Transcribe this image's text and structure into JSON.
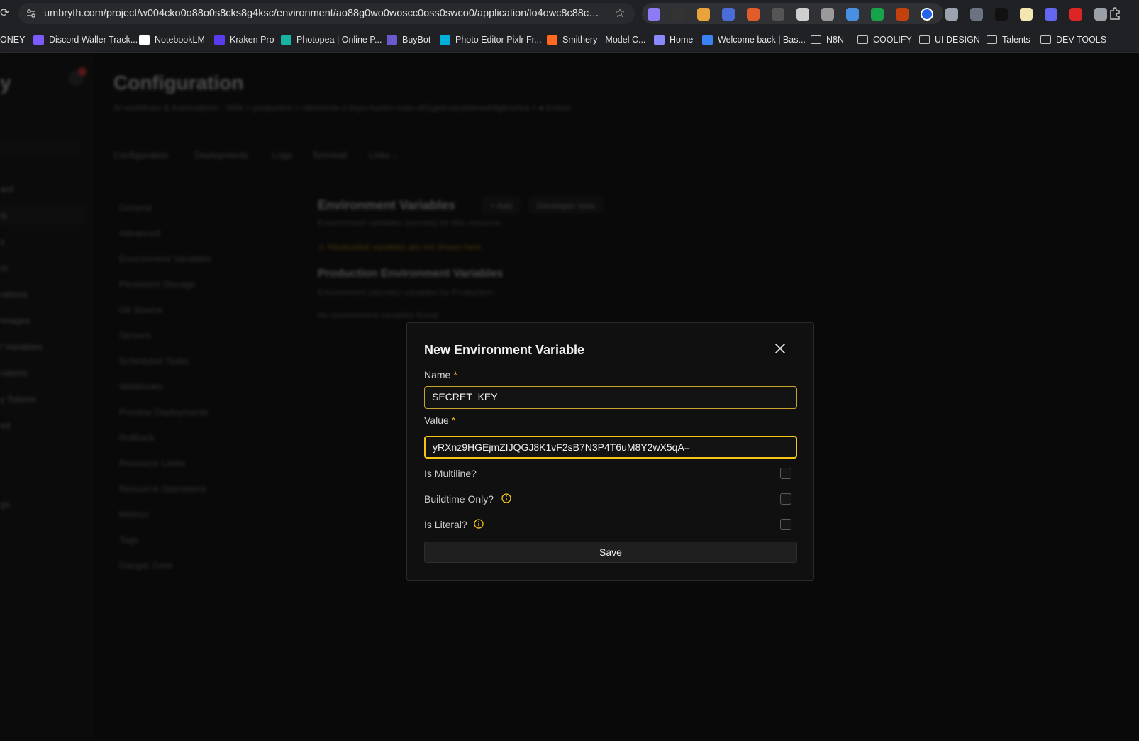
{
  "browser": {
    "url": "umbryth.com/project/w004cko0o88o0s8cks8g4ksc/environment/ao88g0wo0woscc0oss0swco0/application/lo4owc8c88coooo...",
    "extensions": [
      "ext-1",
      "ext-2",
      "ext-3",
      "ext-4",
      "ext-5",
      "ext-6",
      "ext-7",
      "ext-8",
      "ext-9",
      "ext-10",
      "ext-11",
      "ext-12",
      "ext-13",
      "ext-14",
      "ext-15",
      "ext-16",
      "ext-17",
      "ext-18",
      "ext-19"
    ],
    "bookmarks": [
      {
        "label": "ONEY",
        "type": "text"
      },
      {
        "label": "Discord Waller Track...",
        "type": "site",
        "color": "#7c5cff"
      },
      {
        "label": "NotebookLM",
        "type": "site",
        "color": "#ffffff"
      },
      {
        "label": "Kraken Pro",
        "type": "site",
        "color": "#5a3cf0"
      },
      {
        "label": "Photopea | Online P...",
        "type": "site",
        "color": "#17b3a3"
      },
      {
        "label": "BuyBot",
        "type": "site",
        "color": "#6a5acd"
      },
      {
        "label": "Photo Editor Pixlr Fr...",
        "type": "site",
        "color": "#00b0d8"
      },
      {
        "label": "Smithery - Model C...",
        "type": "site",
        "color": "#ff6a1f"
      },
      {
        "label": "Home",
        "type": "site",
        "color": "#8a8aff"
      },
      {
        "label": "Welcome back | Bas...",
        "type": "site",
        "color": "#3b82f6"
      },
      {
        "label": "N8N",
        "type": "folder"
      },
      {
        "label": "COOLIFY",
        "type": "folder"
      },
      {
        "label": "UI DESIGN",
        "type": "folder"
      },
      {
        "label": "Talents",
        "type": "folder"
      },
      {
        "label": "DEV TOOLS",
        "type": "folder"
      }
    ]
  },
  "app": {
    "page_title": "Configuration",
    "breadcrumb": "AI workflows & Automations · N8N > production > n8nchrole-z.lmyo-hunter-main-d01gekosbsk8ewsk9g6os0ca > ● Exited",
    "tabs": [
      "Configuration",
      "Deployments",
      "Logs",
      "Terminal",
      "Links ↓"
    ],
    "sidebar_items": [
      "ard",
      "ts",
      "s",
      "rs",
      "rations",
      "Images",
      "l Variables",
      "rations",
      "y Tokens",
      "ed",
      "",
      "",
      "gs"
    ],
    "config_menu": [
      "General",
      "Advanced",
      "Environment Variables",
      "Persistent Storage",
      "Git Source",
      "Servers",
      "Scheduled Tasks",
      "Webhooks",
      "Preview Deployments",
      "Rollback",
      "Resource Limits",
      "Resource Operations",
      "Metrics",
      "Tags",
      "Danger Zone"
    ],
    "env_section": {
      "title": "Environment Variables",
      "add_label": "+ Add",
      "dev_view_label": "Developer view",
      "subtitle": "Environment variables (secrets) for this resource.",
      "warning": "Hardcoded variables are not shown here.",
      "prod_title": "Production Environment Variables",
      "prod_subtitle": "Environment (secrets) variables for Production.",
      "empty": "No environment variables found."
    }
  },
  "modal": {
    "title": "New Environment Variable",
    "name_label": "Name",
    "name_value": "SECRET_KEY",
    "value_label": "Value",
    "value_value": "yRXnz9HGEjmZIJQGJ8K1vF2sB7N3P4T6uM8Y2wX5qA=",
    "required_mark": "*",
    "options": [
      {
        "label": "Is Multiline?",
        "info": false,
        "checked": false
      },
      {
        "label": "Buildtime Only?",
        "info": true,
        "checked": false
      },
      {
        "label": "Is Literal?",
        "info": true,
        "checked": false
      }
    ],
    "save_label": "Save"
  },
  "colors": {
    "accent": "#f5c518",
    "background": "#101010",
    "danger": "#e53935"
  }
}
